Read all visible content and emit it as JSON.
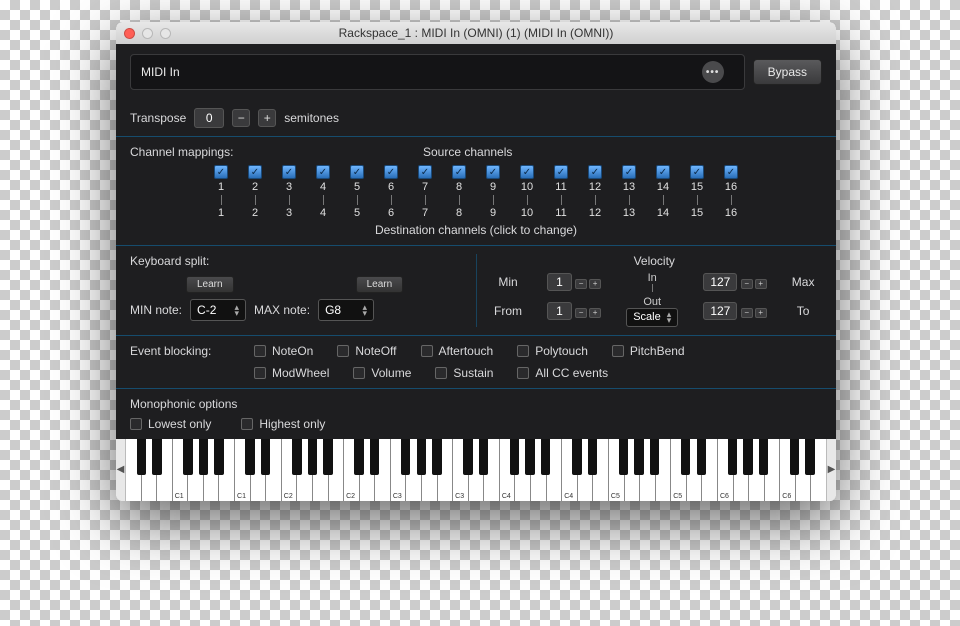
{
  "window": {
    "title": "Rackspace_1 : MIDI In (OMNI) (1) (MIDI In (OMNI))"
  },
  "header": {
    "plugin_name": "MIDI In",
    "bypass": "Bypass"
  },
  "transpose": {
    "label": "Transpose",
    "value": "0",
    "units": "semitones"
  },
  "channel_mappings": {
    "label": "Channel mappings:",
    "source_label": "Source channels",
    "dest_label": "Destination channels (click to change)",
    "channels": [
      {
        "src": "1",
        "dst": "1",
        "checked": true
      },
      {
        "src": "2",
        "dst": "2",
        "checked": true
      },
      {
        "src": "3",
        "dst": "3",
        "checked": true
      },
      {
        "src": "4",
        "dst": "4",
        "checked": true
      },
      {
        "src": "5",
        "dst": "5",
        "checked": true
      },
      {
        "src": "6",
        "dst": "6",
        "checked": true
      },
      {
        "src": "7",
        "dst": "7",
        "checked": true
      },
      {
        "src": "8",
        "dst": "8",
        "checked": true
      },
      {
        "src": "9",
        "dst": "9",
        "checked": true
      },
      {
        "src": "10",
        "dst": "10",
        "checked": true
      },
      {
        "src": "11",
        "dst": "11",
        "checked": true
      },
      {
        "src": "12",
        "dst": "12",
        "checked": true
      },
      {
        "src": "13",
        "dst": "13",
        "checked": true
      },
      {
        "src": "14",
        "dst": "14",
        "checked": true
      },
      {
        "src": "15",
        "dst": "15",
        "checked": true
      },
      {
        "src": "16",
        "dst": "16",
        "checked": true
      }
    ]
  },
  "keyboard_split": {
    "label": "Keyboard split:",
    "learn": "Learn",
    "min_note_label": "MIN note:",
    "min_note": "C-2",
    "max_note_label": "MAX note:",
    "max_note": "G8"
  },
  "velocity": {
    "title": "Velocity",
    "min_label": "Min",
    "in_label": "In",
    "max_label": "Max",
    "from_label": "From",
    "out_label": "Out",
    "to_label": "To",
    "in_min": "1",
    "in_max": "127",
    "out_from": "1",
    "out_to": "127",
    "scale": "Scale"
  },
  "event_blocking": {
    "label": "Event blocking:",
    "events_row1": [
      "NoteOn",
      "NoteOff",
      "Aftertouch",
      "Polytouch",
      "PitchBend"
    ],
    "events_row2": [
      "ModWheel",
      "Volume",
      "Sustain",
      "All CC events"
    ]
  },
  "monophonic": {
    "label": "Monophonic options",
    "lowest": "Lowest only",
    "highest": "Highest only"
  },
  "piano": {
    "octave_labels": [
      "C1",
      "C2",
      "C3",
      "C4",
      "C5",
      "C6"
    ]
  }
}
